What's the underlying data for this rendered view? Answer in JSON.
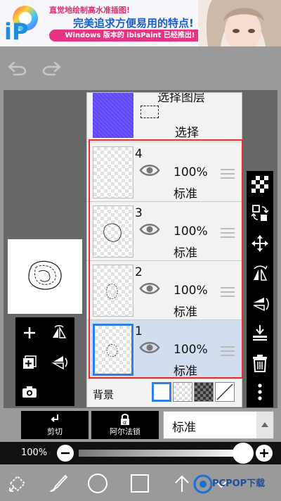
{
  "ad": {
    "line1": "直觉地绘制高水准插图!",
    "line2": "完美追求方便易用的特点!",
    "pill": "Windows 版本的 ibisPaint 已经推出!"
  },
  "selection_layer": {
    "title": "选择图层",
    "label": "选择"
  },
  "layers": [
    {
      "number": "4",
      "opacity": "100%",
      "mode": "标准"
    },
    {
      "number": "3",
      "opacity": "100%",
      "mode": "标准"
    },
    {
      "number": "2",
      "opacity": "100%",
      "mode": "标准"
    },
    {
      "number": "1",
      "opacity": "100%",
      "mode": "标准"
    }
  ],
  "background": {
    "label": "背景",
    "options": [
      "white",
      "checker-light",
      "checker-dark",
      "none"
    ],
    "selected": "white"
  },
  "controls": {
    "clip_label": "剪切",
    "alpha_lock_label": "阿尔法锁",
    "blend_mode": "标准"
  },
  "opacity": {
    "label": "100%",
    "value": 1.0
  },
  "watermark": {
    "text": "PCPOP下载"
  },
  "colors": {
    "selection_accent": "#2f7fe6",
    "red_frame": "#e53030",
    "ad_pink": "#e63482"
  },
  "icons": {
    "left_tools": [
      "add-icon",
      "flip-horizontal-icon",
      "add-layer-icon",
      "flip-vertical-icon",
      "camera-icon"
    ],
    "right_tools": [
      "checkerboard-icon",
      "transform-icon",
      "move-icon",
      "rotate-flip-icon",
      "rotate-flip-vertical-icon",
      "merge-down-icon",
      "trash-icon",
      "more-icon"
    ],
    "bottom_tools": [
      "transform-tool-icon",
      "brush-icon",
      "color-circle-icon",
      "layer-square-icon",
      "arrow-up-icon",
      "chevron-down-icon"
    ]
  }
}
